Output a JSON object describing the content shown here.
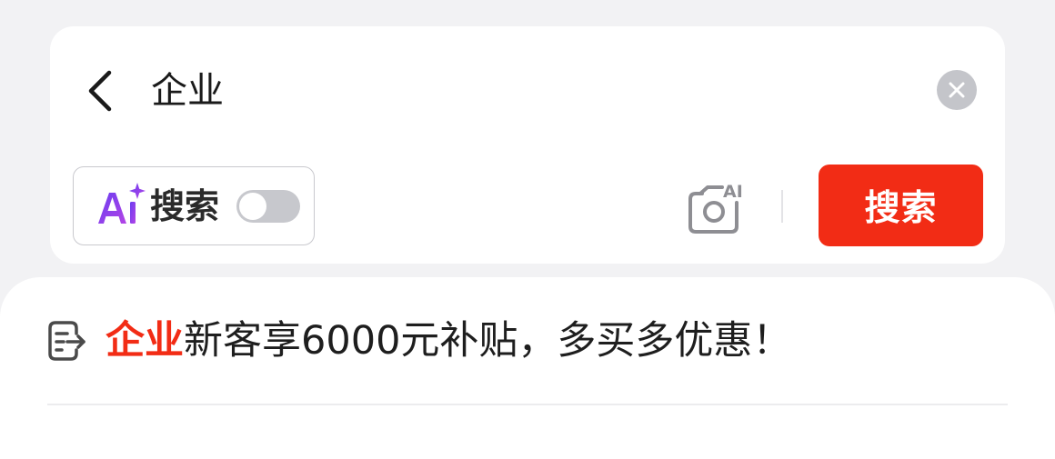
{
  "search": {
    "query": "企业",
    "ai_toggle_label": "搜索",
    "ai_toggle_on": false,
    "submit_label": "搜索",
    "camera_badge": "AI"
  },
  "promo": {
    "highlight": "企业",
    "text": "新客享6000元补贴，多买多优惠！"
  },
  "icons": {
    "back": "back-chevron-icon",
    "clear": "clear-x-icon",
    "ai_logo": "ai-sparkle-logo",
    "camera": "ai-camera-icon",
    "promo": "document-arrow-icon"
  },
  "colors": {
    "accent": "#f22c15",
    "ai_gradient_start": "#6a3df0",
    "ai_gradient_end": "#b445e6",
    "page_background": "#f2f2f4",
    "toggle_off": "#c7c8cd"
  }
}
